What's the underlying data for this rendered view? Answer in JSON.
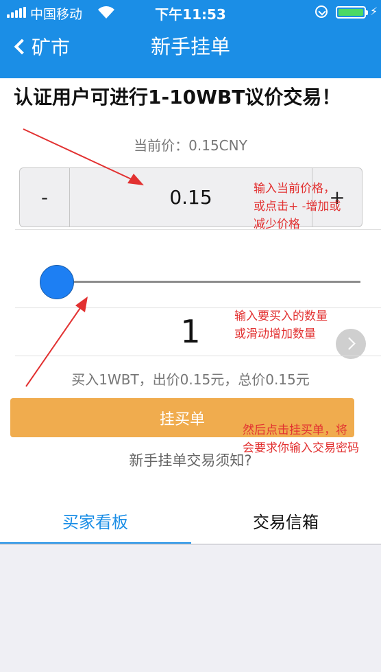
{
  "status_bar": {
    "carrier": "中国移动",
    "time": "下午11:53"
  },
  "nav": {
    "back_label": "矿市",
    "title": "新手挂单"
  },
  "notice": "认证用户可进行1-10WBT议价交易！",
  "current_price": "当前价：0.15CNY",
  "price_stepper": {
    "minus": "-",
    "value": "0.15",
    "plus": "+"
  },
  "slider": {
    "position": 0
  },
  "quantity": "1",
  "summary": "买入1WBT，出价0.15元，总价0.15元",
  "submit_button": "挂买单",
  "help_link": "新手挂单交易须知?",
  "tabs": [
    {
      "label": "买家看板",
      "active": true
    },
    {
      "label": "交易信箱",
      "active": false
    }
  ],
  "annotations": {
    "price_note": [
      "输入当前价格，",
      "或点击+ -增加或",
      "减少价格"
    ],
    "quantity_note": [
      "输入要买入的数量",
      "或滑动增加数量"
    ],
    "submit_note": [
      "然后点击挂买单，将",
      "会要求你输入交易密码"
    ]
  },
  "colors": {
    "header": "#1b8ee6",
    "slider_thumb": "#1d7ff3",
    "submit": "#f0ac4e",
    "annotation": "#e23131",
    "battery": "#4cd964"
  }
}
